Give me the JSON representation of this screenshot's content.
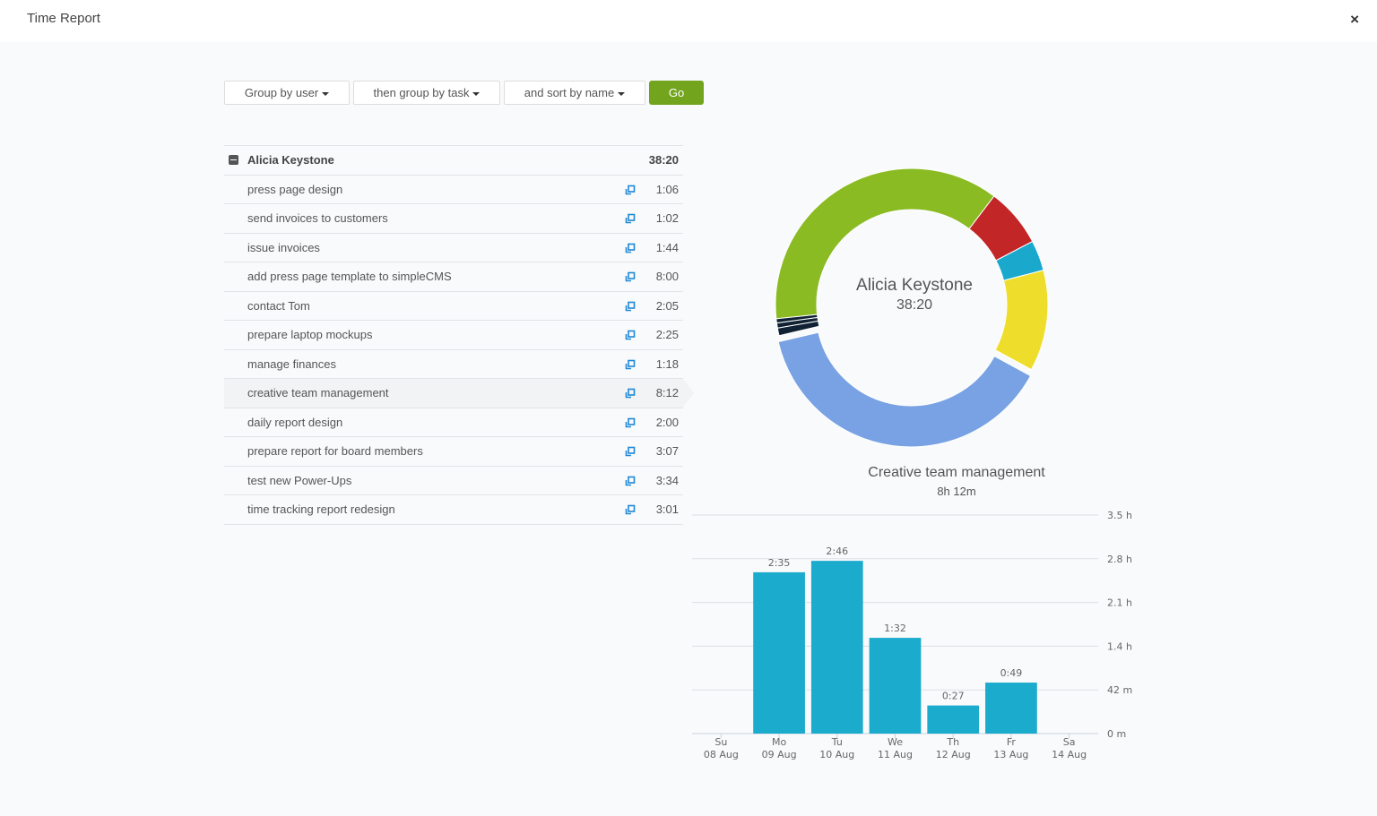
{
  "window": {
    "title": "Time Report",
    "close_label": "×"
  },
  "controls": {
    "group1": "Group by user",
    "group2": "then group by task",
    "sort": "and sort by name",
    "go": "Go"
  },
  "report": {
    "group": {
      "name": "Alicia Keystone",
      "total": "38:20"
    },
    "tasks": [
      {
        "name": "press page design",
        "time": "1:06"
      },
      {
        "name": "send invoices to customers",
        "time": "1:02"
      },
      {
        "name": "issue invoices",
        "time": "1:44"
      },
      {
        "name": "add press page template to simpleCMS",
        "time": "8:00"
      },
      {
        "name": "contact Tom",
        "time": "2:05"
      },
      {
        "name": "prepare laptop mockups",
        "time": "2:25"
      },
      {
        "name": "manage finances",
        "time": "1:18"
      },
      {
        "name": "creative team management",
        "time": "8:12",
        "selected": true
      },
      {
        "name": "daily report design",
        "time": "2:00"
      },
      {
        "name": "prepare report for board members",
        "time": "3:07"
      },
      {
        "name": "test new Power-Ups",
        "time": "3:34"
      },
      {
        "name": "time tracking report redesign",
        "time": "3:01"
      }
    ],
    "icons": {
      "open": "external-open-icon",
      "collapse": "minus-square-icon",
      "close": "close-icon"
    }
  },
  "donut": {
    "center_name": "Alicia Keystone",
    "center_total": "38:20",
    "segments": [
      {
        "color": "#8bbb22",
        "percent": 37.0
      },
      {
        "color": "#c22626",
        "percent": 7.0
      },
      {
        "color": "#1aa9cd",
        "percent": 3.6
      },
      {
        "color": "#efdd2c",
        "percent": 12.0
      },
      {
        "color": "#78a2e3",
        "percent": 38.4,
        "exploded": true
      },
      {
        "color": "#0f2133",
        "percent": 0.9
      },
      {
        "color": "#0f2133",
        "percent": 0.6
      },
      {
        "color": "#0f2133",
        "percent": 0.5
      }
    ],
    "start_angle_deg": 264
  },
  "selected_task": {
    "title": "Creative team management",
    "duration": "8h 12m"
  },
  "chart_data": {
    "type": "bar",
    "title": "Creative team management",
    "categories": [
      "Su 08 Aug",
      "Mo 09 Aug",
      "Tu 10 Aug",
      "We 11 Aug",
      "Th 12 Aug",
      "Fr 13 Aug",
      "Sa 14 Aug"
    ],
    "day_labels": [
      "Su",
      "Mo",
      "Tu",
      "We",
      "Th",
      "Fr",
      "Sa"
    ],
    "date_labels": [
      "08 Aug",
      "09 Aug",
      "10 Aug",
      "11 Aug",
      "12 Aug",
      "13 Aug",
      "14 Aug"
    ],
    "values_minutes": [
      0,
      155,
      166,
      92,
      27,
      49,
      0
    ],
    "value_labels": [
      "",
      "2:35",
      "2:46",
      "1:32",
      "0:27",
      "0:49",
      ""
    ],
    "ylim_minutes": [
      0,
      210
    ],
    "y_ticks_minutes": [
      0,
      42,
      84,
      126,
      168,
      210
    ],
    "y_tick_labels": [
      "0 m",
      "42 m",
      "1.4 h",
      "2.1 h",
      "2.8 h",
      "3.5 h"
    ],
    "y_axis_position": "right",
    "grid": true,
    "bar_color": "#1babcd"
  }
}
